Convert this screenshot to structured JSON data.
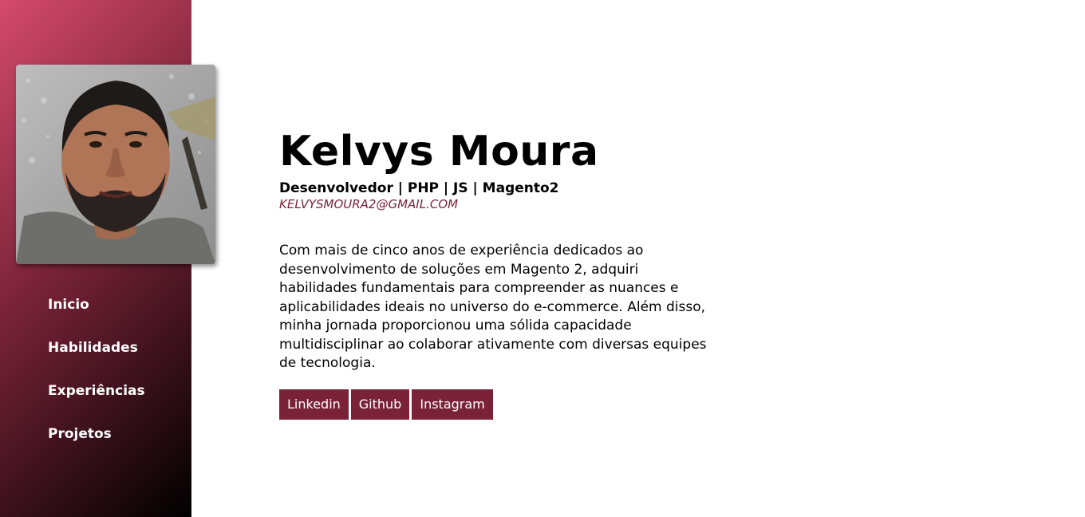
{
  "colors": {
    "accent": "#7a2338",
    "sidebar_gradient_start": "#d44a6c",
    "sidebar_gradient_end": "#000000",
    "background": "#ffffff"
  },
  "sidebar": {
    "avatar_alt": "profile-photo",
    "nav": [
      {
        "label": "Inicio"
      },
      {
        "label": "Habilidades"
      },
      {
        "label": "Experiências"
      },
      {
        "label": "Projetos"
      }
    ]
  },
  "profile": {
    "name": "Kelvys Moura",
    "role": "Desenvolvedor | PHP | JS | Magento2",
    "email": "KELVYSMOURA2@GMAIL.COM",
    "bio": "Com mais de cinco anos de experiência dedicados ao desenvolvimento de soluções em Magento 2, adquiri habilidades fundamentais para compreender as nuances e aplicabilidades ideais no universo do e-commerce. Além disso, minha jornada proporcionou uma sólida capacidade multidisciplinar ao colaborar ativamente com diversas equipes de tecnologia."
  },
  "socials": [
    {
      "label": "Linkedin"
    },
    {
      "label": "Github"
    },
    {
      "label": "Instagram"
    }
  ]
}
